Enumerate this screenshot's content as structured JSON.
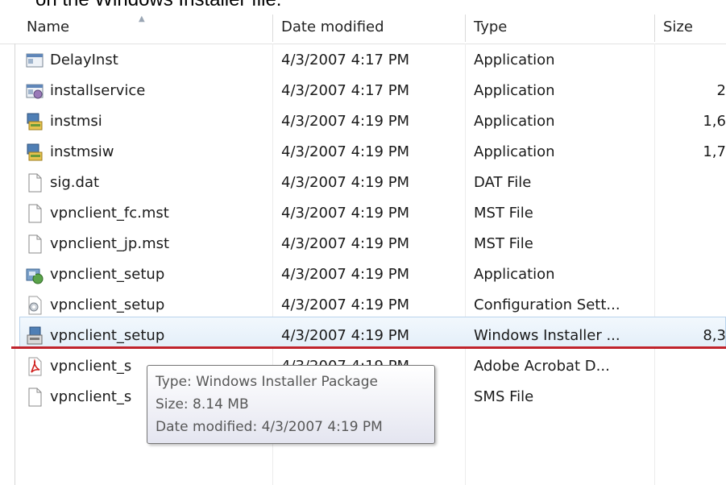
{
  "caption": "on the Windows Installer file:",
  "columns": {
    "name": "Name",
    "date": "Date modified",
    "type": "Type",
    "size": "Size"
  },
  "files": [
    {
      "icon": "application-icon",
      "name": "DelayInst",
      "date": "4/3/2007 4:17 PM",
      "type": "Application",
      "size": ""
    },
    {
      "icon": "installservice-icon",
      "name": "installservice",
      "date": "4/3/2007 4:17 PM",
      "type": "Application",
      "size": "2"
    },
    {
      "icon": "installer-app-icon",
      "name": "instmsi",
      "date": "4/3/2007 4:19 PM",
      "type": "Application",
      "size": "1,6"
    },
    {
      "icon": "installer-app-icon",
      "name": "instmsiw",
      "date": "4/3/2007 4:19 PM",
      "type": "Application",
      "size": "1,7"
    },
    {
      "icon": "generic-file-icon",
      "name": "sig.dat",
      "date": "4/3/2007 4:19 PM",
      "type": "DAT File",
      "size": ""
    },
    {
      "icon": "generic-file-icon",
      "name": "vpnclient_fc.mst",
      "date": "4/3/2007 4:19 PM",
      "type": "MST File",
      "size": ""
    },
    {
      "icon": "generic-file-icon",
      "name": "vpnclient_jp.mst",
      "date": "4/3/2007 4:19 PM",
      "type": "MST File",
      "size": ""
    },
    {
      "icon": "setup-app-icon",
      "name": "vpnclient_setup",
      "date": "4/3/2007 4:19 PM",
      "type": "Application",
      "size": ""
    },
    {
      "icon": "config-settings-icon",
      "name": "vpnclient_setup",
      "date": "4/3/2007 4:19 PM",
      "type": "Configuration Sett...",
      "size": ""
    },
    {
      "icon": "msi-package-icon",
      "name": "vpnclient_setup",
      "date": "4/3/2007 4:19 PM",
      "type": "Windows Installer ...",
      "size": "8,3"
    },
    {
      "icon": "pdf-icon",
      "name": "vpnclient_s",
      "date": "4/3/2007 4:19 PM",
      "type": "Adobe Acrobat D...",
      "size": ""
    },
    {
      "icon": "generic-file-icon",
      "name": "vpnclient_s",
      "date": "",
      "type": "SMS File",
      "size": ""
    }
  ],
  "tooltip": {
    "type": "Type: Windows Installer Package",
    "size": "Size: 8.14 MB",
    "date": "Date modified: 4/3/2007 4:19 PM"
  },
  "colors": {
    "selection_border": "#b9d3ec",
    "annotation_line": "#c0232c"
  }
}
